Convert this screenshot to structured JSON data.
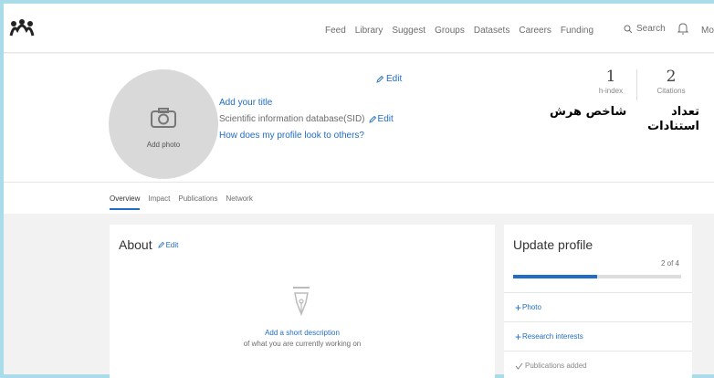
{
  "nav": {
    "items": [
      "Feed",
      "Library",
      "Suggest",
      "Groups",
      "Datasets",
      "Careers",
      "Funding"
    ],
    "search_label": "Search",
    "more_label": "Mo"
  },
  "profile": {
    "add_photo": "Add photo",
    "edit_label": "Edit",
    "title_link": "Add your title",
    "affiliation": "Scientific information database(SID)",
    "affiliation_edit": "Edit",
    "look_link": "How does my profile look to others?",
    "h_index": {
      "value": "1",
      "label": "h-index"
    },
    "citations": {
      "value": "2",
      "label": "Citations"
    },
    "annotation_h": "شاخص هرش",
    "annotation_c_line1": "تعداد",
    "annotation_c_line2": "استنادات"
  },
  "tabs": [
    "Overview",
    "Impact",
    "Publications",
    "Network"
  ],
  "about": {
    "title": "About",
    "edit": "Edit",
    "desc_link": "Add a short description",
    "desc_sub": "of what you are currently working on"
  },
  "update": {
    "title": "Update profile",
    "count": "2 of 4",
    "progress": 0.5,
    "items": [
      {
        "label": "Photo",
        "done": false
      },
      {
        "label": "Research interests",
        "done": false
      },
      {
        "label": "Publications added",
        "done": true
      }
    ]
  },
  "colors": {
    "accent": "#1f6dc4",
    "frame": "#a9dbe9"
  }
}
